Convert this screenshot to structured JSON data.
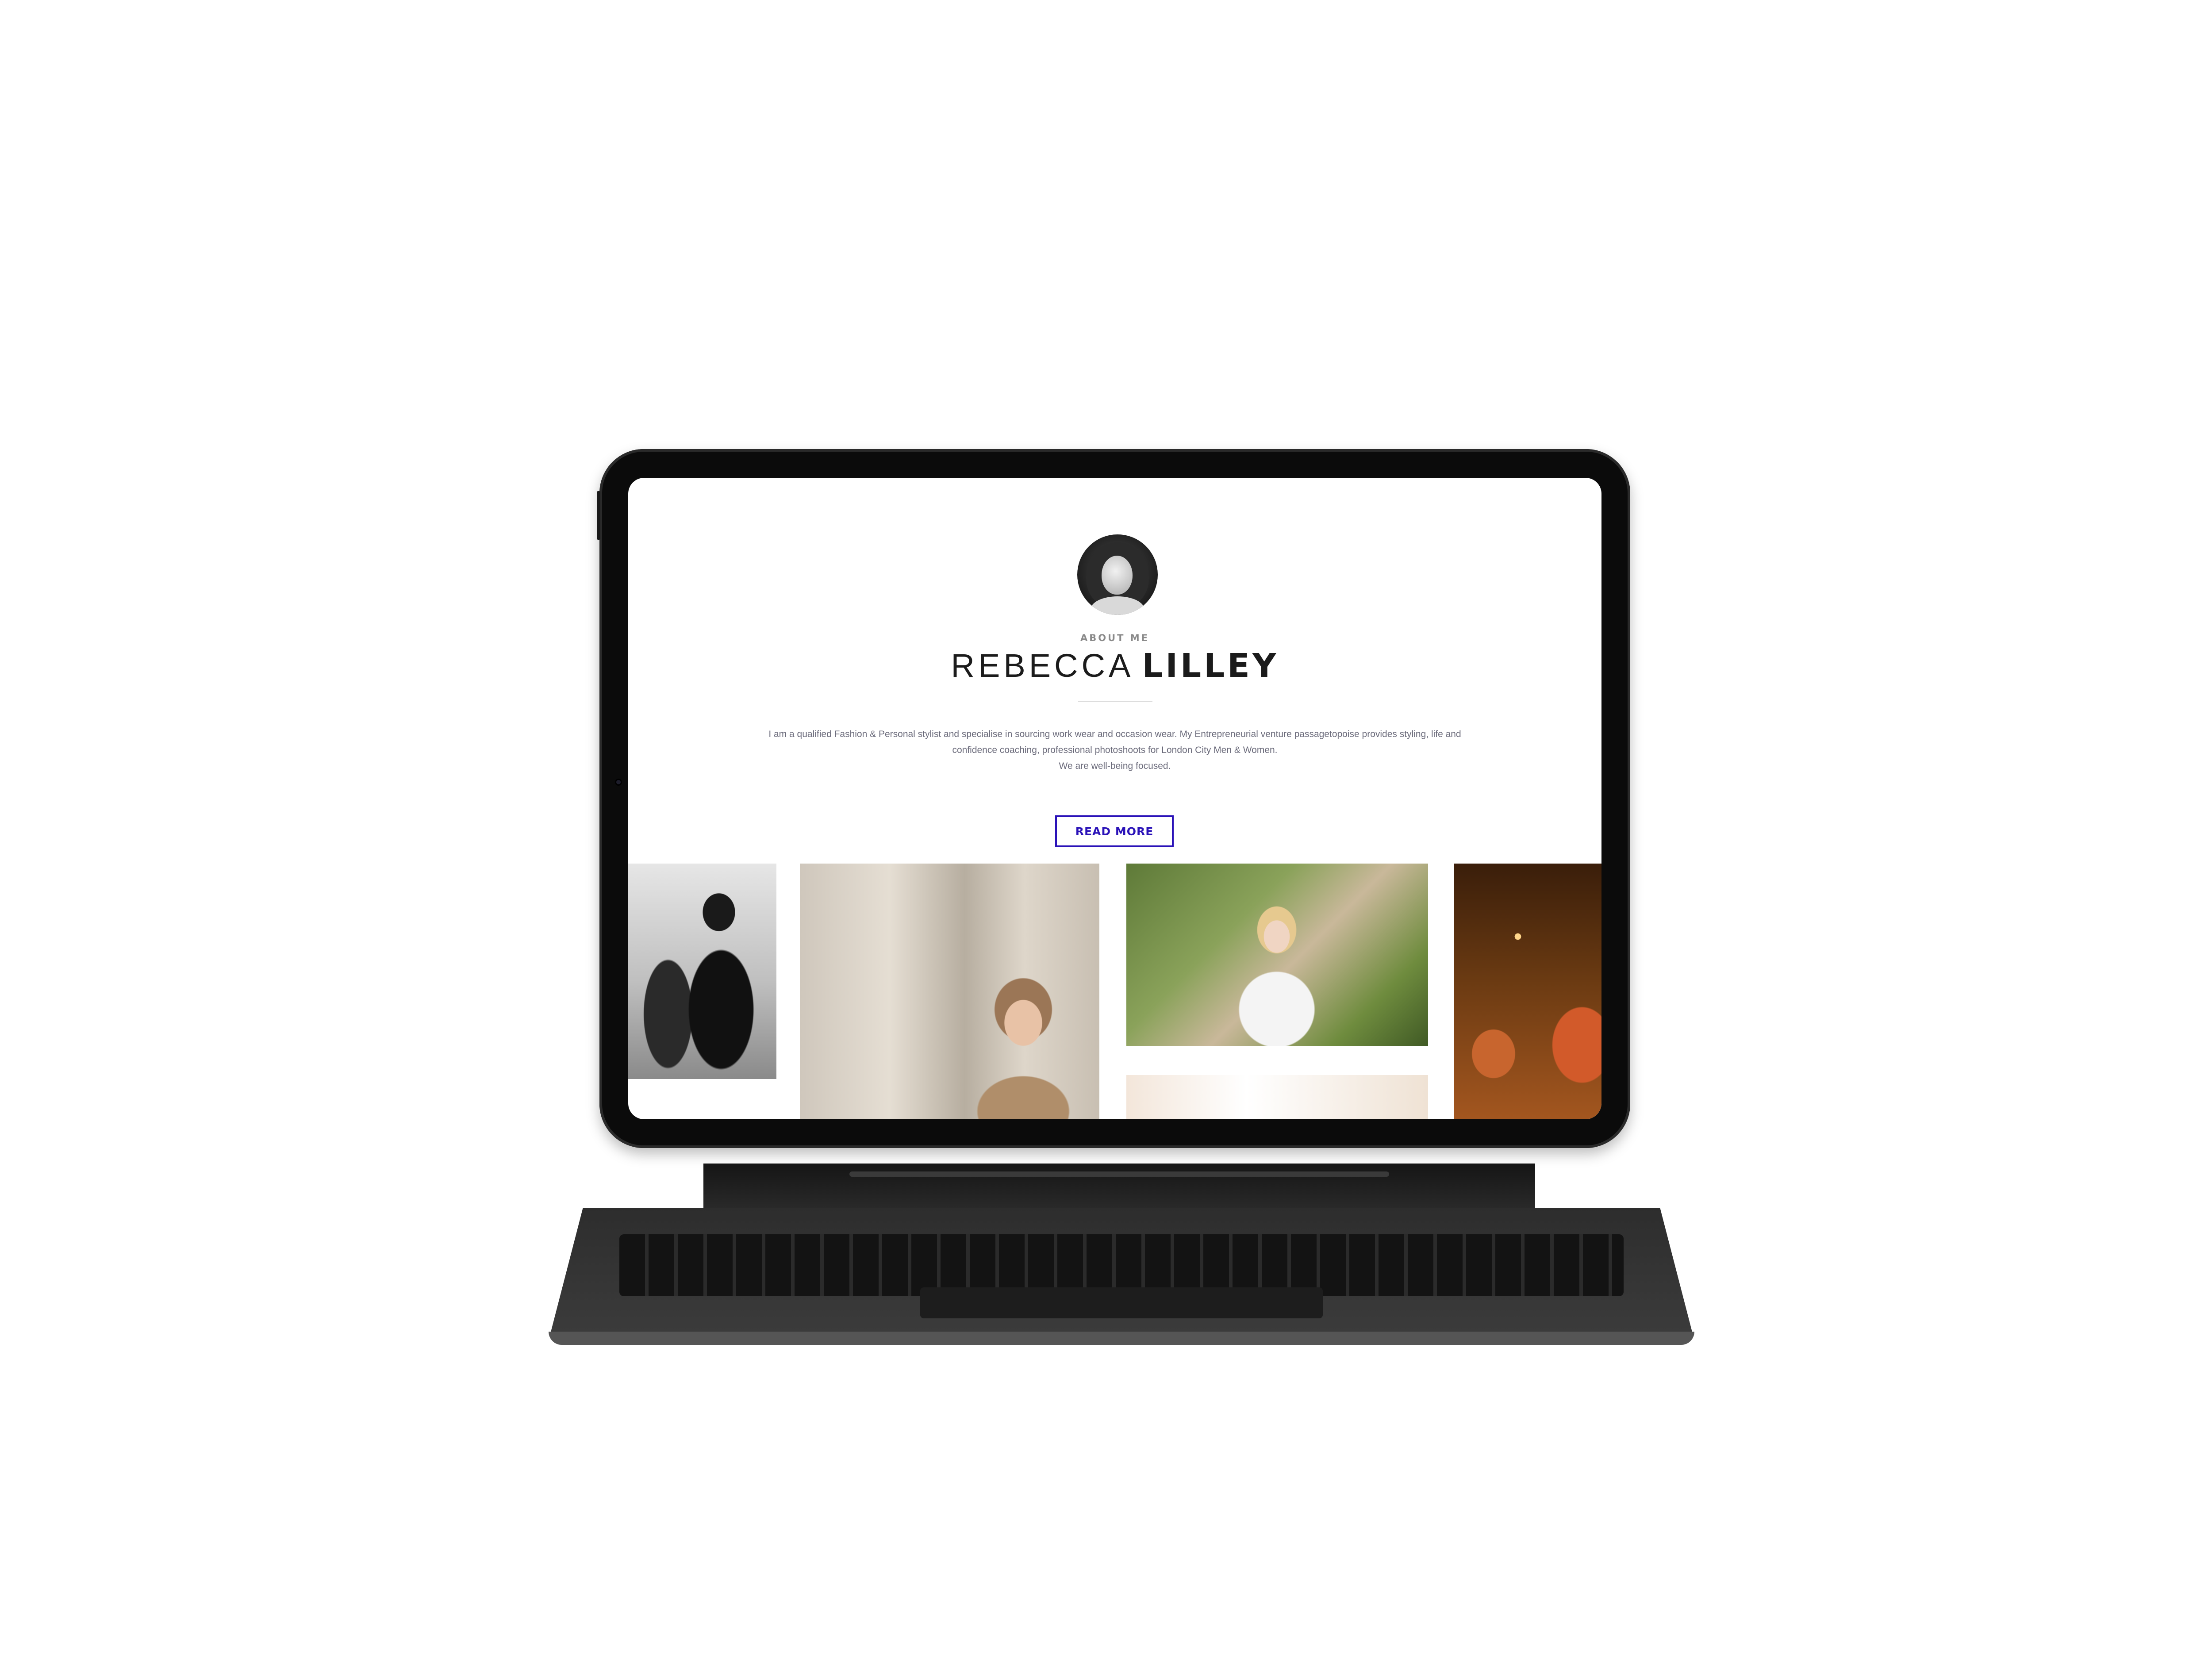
{
  "profile": {
    "eyebrow": "ABOUT ME",
    "first_name": "REBECCA",
    "last_name": "LILLEY",
    "bio_lines": [
      "I am a qualified Fashion & Personal stylist and specialise in sourcing work wear and occasion wear. My Entrepreneurial venture passagetopoise provides styling, life and",
      "confidence coaching, professional photoshoots for London City Men & Women.",
      "We are well-being focused."
    ],
    "cta_label": "READ MORE"
  },
  "colors": {
    "accent": "#2a12b8",
    "body_text": "#6a6a7a",
    "heading": "#1b1b1b",
    "eyebrow": "#8a8a8a"
  },
  "gallery": {
    "photos": [
      "fashion-photo-bw",
      "fashion-photo-street",
      "fashion-photo-garden",
      "fashion-photo-warm"
    ]
  }
}
